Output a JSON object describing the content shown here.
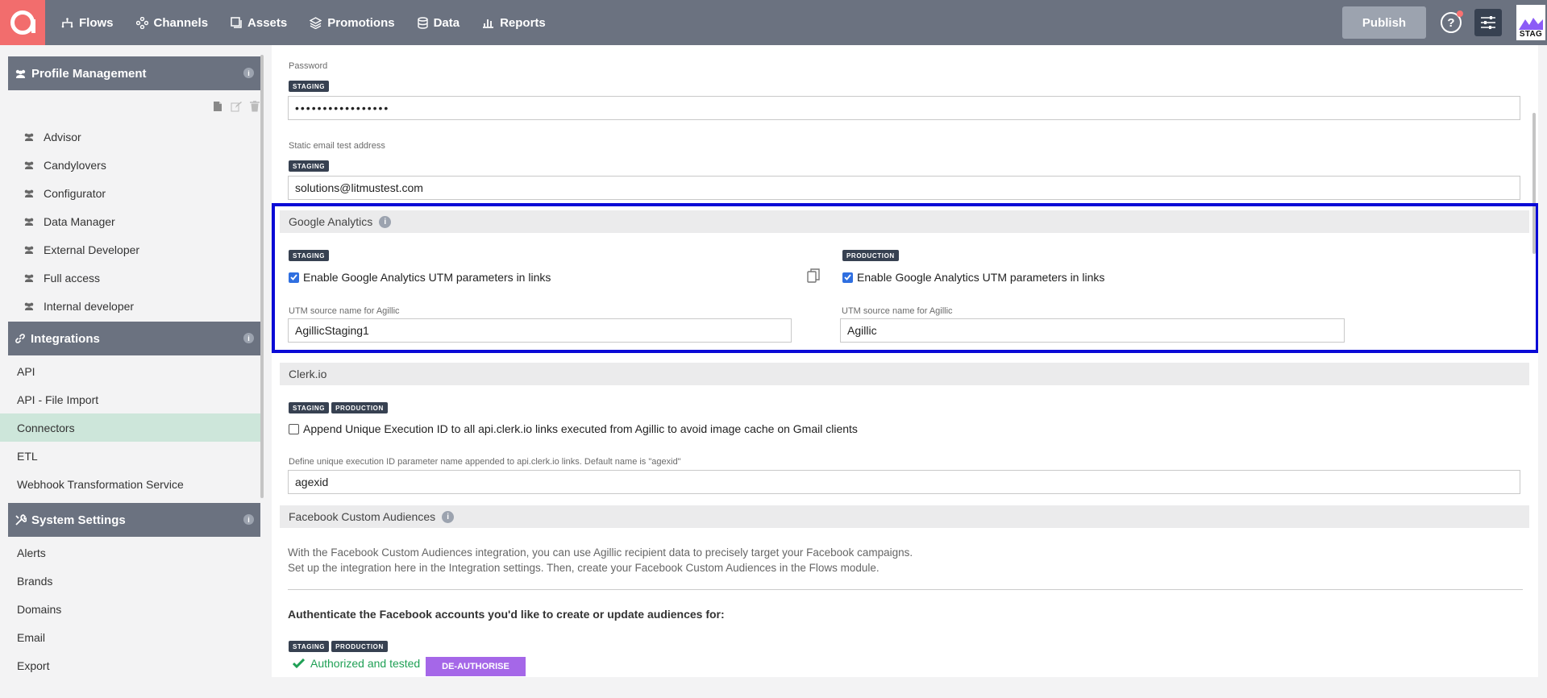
{
  "topbar": {
    "nav": [
      {
        "label": "Flows",
        "icon": "flows-icon"
      },
      {
        "label": "Channels",
        "icon": "channels-icon"
      },
      {
        "label": "Assets",
        "icon": "assets-icon"
      },
      {
        "label": "Promotions",
        "icon": "promotions-icon"
      },
      {
        "label": "Data",
        "icon": "data-icon"
      },
      {
        "label": "Reports",
        "icon": "reports-icon"
      }
    ],
    "publish_label": "Publish",
    "help_label": "?",
    "env_badge": "STAG"
  },
  "sidebar": {
    "profile_management": {
      "title": "Profile Management",
      "items": [
        "Advisor",
        "Candylovers",
        "Configurator",
        "Data Manager",
        "External Developer",
        "Full access",
        "Internal developer"
      ]
    },
    "integrations": {
      "title": "Integrations",
      "items": [
        "API",
        "API - File Import",
        "Connectors",
        "ETL",
        "Webhook Transformation Service"
      ],
      "active": "Connectors"
    },
    "system_settings": {
      "title": "System Settings",
      "items": [
        "Alerts",
        "Brands",
        "Domains",
        "Email",
        "Export"
      ]
    },
    "info_glyph": "i"
  },
  "main": {
    "password": {
      "label": "Password",
      "tag": "STAGING",
      "value": "•••••••••••••••••"
    },
    "static_email": {
      "label": "Static email test address",
      "tag": "STAGING",
      "value": "solutions@litmustest.com"
    },
    "google_analytics": {
      "title": "Google Analytics",
      "staging": {
        "tag": "STAGING",
        "checkbox_label": "Enable Google Analytics UTM parameters in links",
        "checked": true,
        "utm_label": "UTM source name for Agillic",
        "utm_value": "AgillicStaging1"
      },
      "production": {
        "tag": "PRODUCTION",
        "checkbox_label": "Enable Google Analytics UTM parameters in links",
        "checked": true,
        "utm_label": "UTM source name for Agillic",
        "utm_value": "Agillic"
      }
    },
    "clerk": {
      "title": "Clerk.io",
      "tags": [
        "STAGING",
        "PRODUCTION"
      ],
      "checkbox_label": "Append Unique Execution ID to all api.clerk.io links executed from Agillic to avoid image cache on Gmail clients",
      "checked": false,
      "param_label": "Define unique execution ID parameter name appended to api.clerk.io links. Default name is \"agexid\"",
      "param_value": "agexid"
    },
    "facebook": {
      "title": "Facebook Custom Audiences",
      "desc_line1": "With the Facebook Custom Audiences integration, you can use Agillic recipient data to precisely target your Facebook campaigns.",
      "desc_line2": "Set up the integration here in the Integration settings. Then, create your Facebook Custom Audiences in the Flows module.",
      "auth_question": "Authenticate the Facebook accounts you'd like to create or update audiences for:",
      "tags": [
        "STAGING",
        "PRODUCTION"
      ],
      "status": "Authorized and tested",
      "deauth_label": "DE-AUTHORISE"
    },
    "colors": {
      "highlight": "#0a0ad6",
      "topbar": "#6b7280",
      "active_item": "#cde6da",
      "deauth": "#a567e8",
      "success": "#1fa055"
    }
  }
}
